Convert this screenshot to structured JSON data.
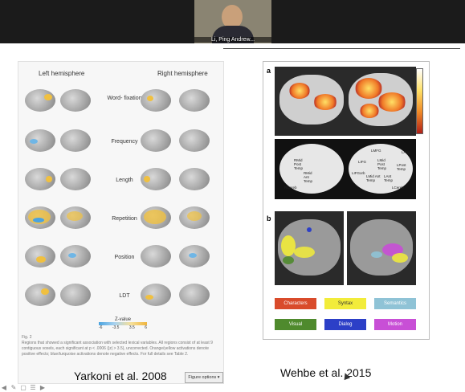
{
  "video": {
    "name": "Li, Ping Andrew..."
  },
  "left_figure": {
    "left_hemisphere": "Left hemisphere",
    "right_hemisphere": "Right hemisphere",
    "rows": [
      "Word-\nfixation",
      "Frequency",
      "Length",
      "Repetition",
      "Position",
      "LDT"
    ],
    "zvalue_label": "Z-value",
    "ticks": [
      "-6",
      "-3.5",
      "3.5",
      "6"
    ],
    "caption_label": "Fig. 2",
    "caption": "Regions that showed a significant association with selected lexical variables. All regions consist of at least 9 contiguous voxels, each significant at p < .0006 (|z| > 3.5), uncorrected. Orange/yellow activations denote positive effects; blue/turquoise activations denote negative effects. For full details see Table 2.",
    "figure_options": "Figure options ▾",
    "reference": "Yarkoni et al. 2008"
  },
  "right_figure": {
    "panel_a": "a",
    "panel_b": "b",
    "regions": [
      "LMFG",
      "LIFG",
      "LMid Post Temp",
      "LAnt Temp",
      "LIFGorb",
      "LAng",
      "LPost Temp",
      "RMid Post Temp",
      "RMid Ant Temp",
      "RCereb",
      "LCereb",
      "LMid Ant Temp"
    ],
    "legend": [
      {
        "label": "Characters",
        "color": "#d94b2b"
      },
      {
        "label": "Syntax",
        "color": "#f2ec3a"
      },
      {
        "label": "Semantics",
        "color": "#8fc3d6"
      },
      {
        "label": "Visual",
        "color": "#4f8a2d"
      },
      {
        "label": "Dialog",
        "color": "#2c3fc7"
      },
      {
        "label": "Motion",
        "color": "#c84fd6"
      }
    ],
    "reference": "Wehbe et al. 2015"
  }
}
